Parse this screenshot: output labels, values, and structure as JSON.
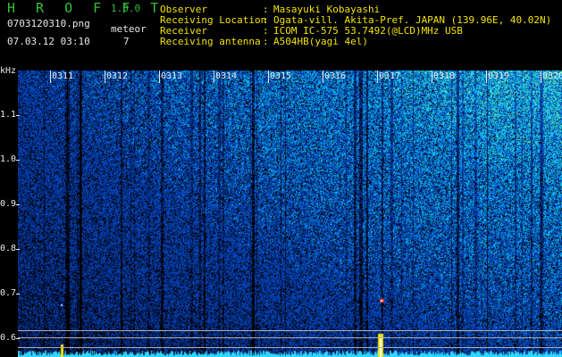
{
  "header": {
    "app_title": "H R O F F T",
    "app_version": "1.0.0",
    "file_name": "0703120310.png",
    "date_time": "07.03.12 03:10",
    "meteor_label": "meteor",
    "meteor_count": "7"
  },
  "info": {
    "observer": {
      "key": "Observer",
      "sep": ":",
      "value": "Masayuki Kobayashi"
    },
    "location": {
      "key": "Receiving Location",
      "sep": ":",
      "value": "Ogata-vill. Akita-Pref. JAPAN (139.96E, 40.02N)"
    },
    "receiver": {
      "key": "Receiver",
      "sep": ":",
      "value": "ICOM IC-575 53.7492(@LCD)MHz USB"
    },
    "antenna": {
      "key": "Receiving antenna",
      "sep": ":",
      "value": "A504HB(yagi 4el)"
    }
  },
  "axis": {
    "frequency_unit": "kHz",
    "frequency_ticks": [
      "1.1",
      "1.0",
      "0.9",
      "0.8",
      "0.7",
      "0.6"
    ],
    "time_ticks": [
      "0311",
      "0312",
      "0313",
      "0314",
      "0315",
      "0316",
      "0317",
      "0318",
      "0319",
      "0320"
    ]
  },
  "colors": {
    "background": "#000000",
    "title_green": "#2fbf3a",
    "info_yellow": "#f2e200",
    "axis_white": "#e8e8e8",
    "noise_low": "#0b2a6e",
    "noise_high": "#2fd3a0",
    "echo_red": "#ff3030",
    "baseline_cyan": "#2fd7ff",
    "baseline_yellow": "#f2e200"
  }
}
